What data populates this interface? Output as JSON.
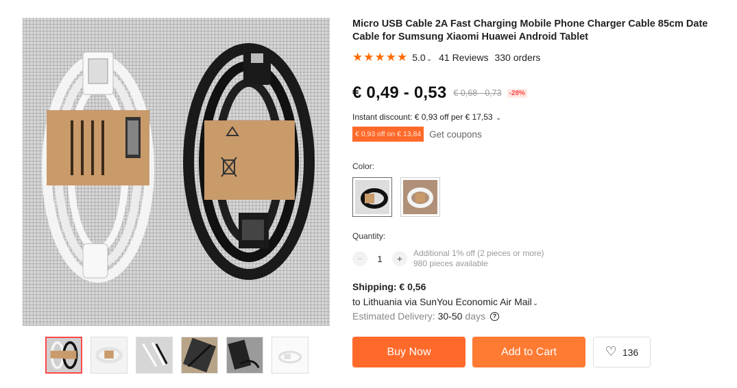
{
  "product": {
    "title": "Micro USB Cable 2A Fast Charging Mobile Phone Charger Cable 85cm Date Cable for Sumsung Xiaomi Huawei Android Tablet",
    "rating": "5.0",
    "reviews": "41 Reviews",
    "orders": "330 orders"
  },
  "price": {
    "current": "€ 0,49 - 0,53",
    "original": "€ 0,68 - 0,73",
    "discount": "-28%"
  },
  "discount": {
    "instant": "Instant discount: € 0,93 off per € 17,53",
    "coupon_tag": "€ 0,93 off on € 13,84",
    "get_coupons": "Get coupons"
  },
  "color": {
    "label": "Color:"
  },
  "quantity": {
    "label": "Quantity:",
    "value": "1",
    "minus": "−",
    "plus": "+",
    "note_line1": "Additional 1% off (2 pieces or more)",
    "note_line2": "980 pieces available"
  },
  "shipping": {
    "price": "Shipping: € 0,56",
    "destination": "to Lithuania via SunYou Economic Air Mail",
    "delivery_label": "Estimated Delivery:",
    "delivery_days": "30-50",
    "delivery_unit": "days",
    "help": "?"
  },
  "actions": {
    "buy_now": "Buy Now",
    "add_to_cart": "Add to Cart",
    "wishlist_count": "136"
  },
  "icons": {
    "star": "★",
    "chevron": "⌄",
    "heart": "♡"
  },
  "colors": {
    "accent": "#ff6a2b",
    "star": "#ff6a00",
    "sale": "#ff4747"
  },
  "gallery": {
    "thumbnail_count": 6,
    "active_thumbnail": 1
  }
}
